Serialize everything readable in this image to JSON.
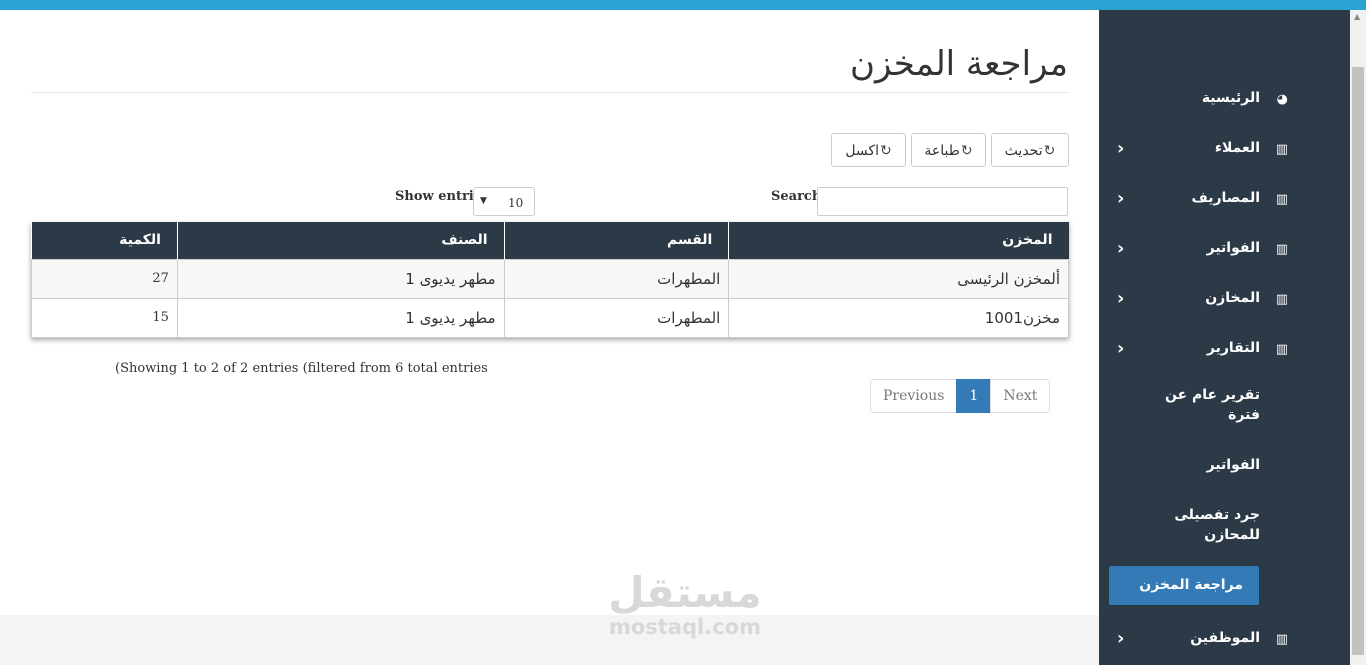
{
  "page": {
    "title": "مراجعة المخزن"
  },
  "toolbar": {
    "refresh_label": "تحديث",
    "print_label": "طباعة",
    "excel_label": "اكسل"
  },
  "filters": {
    "search_label": "Search:",
    "show_entries_label": "Show entries",
    "entries_value": "10"
  },
  "table": {
    "headers": [
      "المخزن",
      "القسم",
      "الصنف",
      "الكمية"
    ],
    "rows": [
      [
        "ألمخزن الرئيسى",
        "المطهرات",
        "مطهر يديوى 1",
        "27"
      ],
      [
        "مخزن1001",
        "المطهرات",
        "مطهر يديوى 1",
        "15"
      ]
    ]
  },
  "info_text": "(Showing 1 to 2 of 2 entries (filtered from 6 total entries",
  "pagination": {
    "previous": "Previous",
    "current": "1",
    "next": "Next"
  },
  "sidebar": {
    "items": [
      {
        "label": "الرئيسية",
        "icon": "dashboard-icon"
      },
      {
        "label": "العملاء",
        "icon": "bar-chart-icon"
      },
      {
        "label": "المصاريف",
        "icon": "bar-chart-icon"
      },
      {
        "label": "الفواتير",
        "icon": "bar-chart-icon"
      },
      {
        "label": "المخازن",
        "icon": "bar-chart-icon"
      },
      {
        "label": "التقارير",
        "icon": "bar-chart-icon"
      }
    ],
    "report_sub": [
      {
        "label": "تقرير عام عن فترة"
      },
      {
        "label": "الفواتير"
      },
      {
        "label": "جرد تفصيلى للمحازن"
      },
      {
        "label": "مراجعة المخزن"
      }
    ],
    "employees": {
      "label": "الموظفين",
      "icon": "bar-chart-icon"
    }
  },
  "watermark": {
    "arabic": "مستقل",
    "latin": "mostaql.com"
  },
  "colors": {
    "topbar": "#29a3d2",
    "sidebar": "#2c3a47",
    "accent": "#337ab7"
  }
}
